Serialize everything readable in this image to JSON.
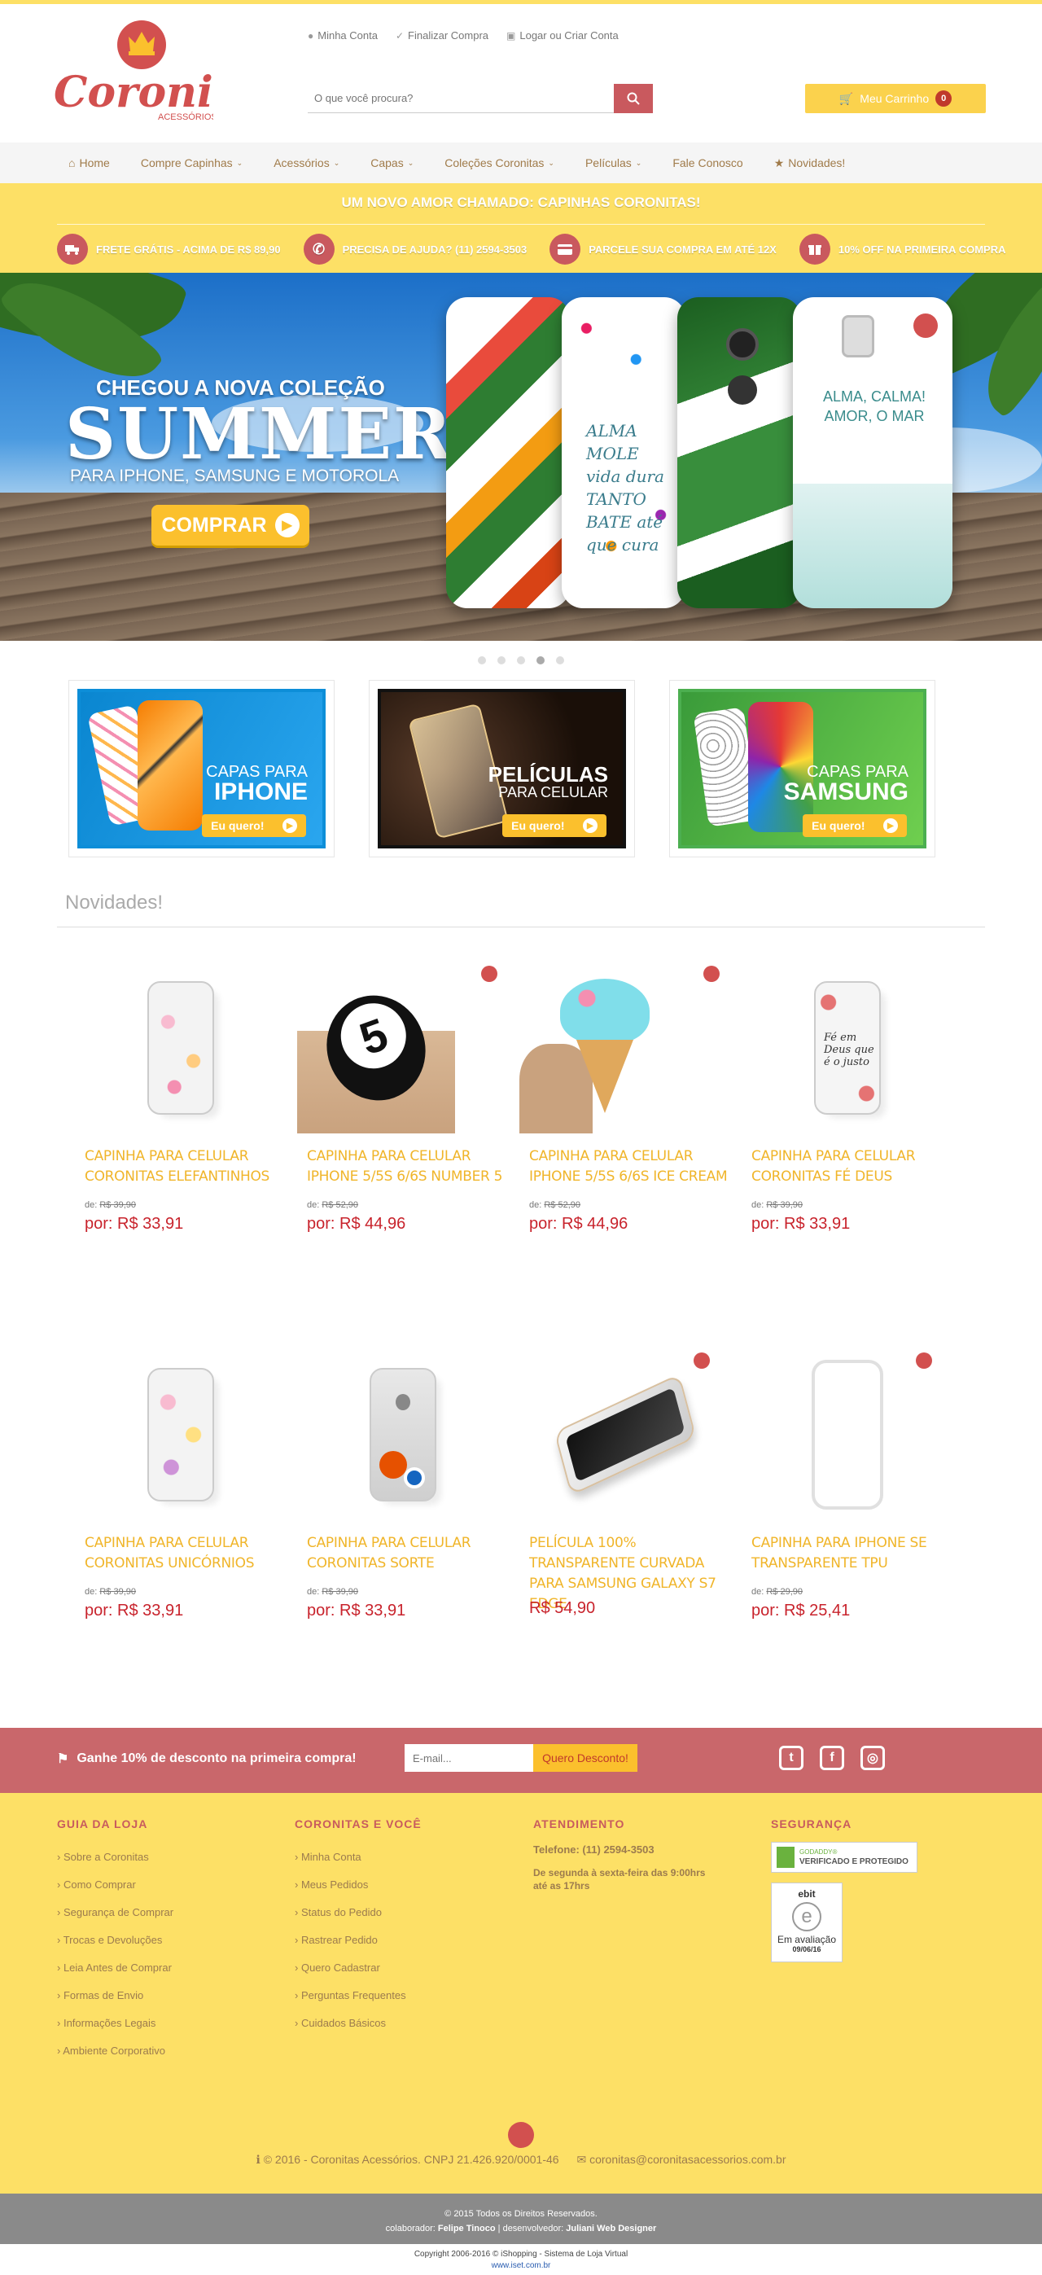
{
  "brand": {
    "name": "Coronitas",
    "tagline": "ACESSÓRIOS",
    "accent": "#c9595e",
    "yellow": "#fde066",
    "price_red": "#c8232c",
    "title_gold": "#f0b52a"
  },
  "account_links": [
    {
      "icon": "user-icon",
      "label": "Minha Conta"
    },
    {
      "icon": "check-icon",
      "label": "Finalizar Compra"
    },
    {
      "icon": "lock-icon",
      "label": "Logar ou Criar Conta"
    }
  ],
  "search": {
    "placeholder": "O que você procura?"
  },
  "cart": {
    "label": "Meu Carrinho",
    "count": "0"
  },
  "nav": [
    {
      "label": "Home",
      "icon": "home-icon"
    },
    {
      "label": "Compre Capinhas"
    },
    {
      "label": "Acessórios"
    },
    {
      "label": "Capas"
    },
    {
      "label": "Coleções Coronitas"
    },
    {
      "label": "Películas"
    },
    {
      "label": "Fale Conosco"
    },
    {
      "label": "Novidades!",
      "icon": "star-icon"
    }
  ],
  "promo_line": "UM NOVO AMOR CHAMADO: CAPINHAS CORONITAS!",
  "benefits": [
    {
      "icon": "truck-icon",
      "text": "FRETE GRÁTIS - ACIMA DE R$ 89,90"
    },
    {
      "icon": "phone-icon",
      "text": "PRECISA DE AJUDA? (11) 2594-3503"
    },
    {
      "icon": "card-icon",
      "text": "PARCELE SUA COMPRA EM ATÉ 12X"
    },
    {
      "icon": "gift-icon",
      "text": "10% OFF NA PRIMEIRA COMPRA"
    }
  ],
  "hero": {
    "kicker": "CHEGOU A NOVA COLEÇÃO",
    "title": "SUMMER",
    "subtitle": "PARA IPHONE, SAMSUNG E MOTOROLA",
    "cta": "COMPRAR",
    "case2_text": "ALMA MOLE vida dura TANTO BATE até que cura",
    "case4_text": "ALMA, CALMA! AMOR, O MAR",
    "dots": 5,
    "active_dot": 4
  },
  "categories": [
    {
      "small": "CAPAS PARA",
      "big": "IPHONE",
      "button": "Eu quero!"
    },
    {
      "small": "PARA CELULAR",
      "big": "PELÍCULAS",
      "button": "Eu quero!"
    },
    {
      "small": "CAPAS PARA",
      "big": "SAMSUNG",
      "button": "Eu quero!"
    }
  ],
  "section_title": "Novidades!",
  "products": [
    {
      "name": "CAPINHA PARA CELULAR CORONITAS ELEFANTINHOS",
      "old_label": "de:",
      "old": "R$ 39,90",
      "new": "por: R$ 33,91"
    },
    {
      "name": "CAPINHA PARA CELULAR IPHONE 5/5S 6/6S NUMBER 5",
      "old_label": "de:",
      "old": "R$ 52,90",
      "new": "por: R$ 44,96"
    },
    {
      "name": "CAPINHA PARA CELULAR IPHONE 5/5S 6/6S ICE CREAM",
      "old_label": "de:",
      "old": "R$ 52,90",
      "new": "por: R$ 44,96"
    },
    {
      "name": "CAPINHA PARA CELULAR CORONITAS FÉ DEUS",
      "old_label": "de:",
      "old": "R$ 39,90",
      "new": "por: R$ 33,91"
    },
    {
      "name": "CAPINHA PARA CELULAR CORONITAS UNICÓRNIOS",
      "old_label": "de:",
      "old": "R$ 39,90",
      "new": "por: R$ 33,91"
    },
    {
      "name": "CAPINHA PARA CELULAR CORONITAS SORTE",
      "old_label": "de:",
      "old": "R$ 39,90",
      "new": "por: R$ 33,91"
    },
    {
      "name": "PELÍCULA 100% TRANSPARENTE CURVADA PARA SAMSUNG GALAXY S7 EDGE",
      "old_label": "",
      "old": "",
      "new": "R$ 54,90"
    },
    {
      "name": "CAPINHA PARA IPHONE SE TRANSPARENTE TPU",
      "old_label": "de:",
      "old": "R$ 29,90",
      "new": "por: R$ 25,41"
    }
  ],
  "newsletter": {
    "text": "Ganhe 10% de desconto na primeira compra!",
    "placeholder": "E-mail...",
    "button": "Quero Desconto!",
    "social": [
      "twitter-icon",
      "facebook-icon",
      "instagram-icon"
    ]
  },
  "footer": {
    "guide": {
      "title": "GUIA DA LOJA",
      "links": [
        "Sobre a Coronitas",
        "Como Comprar",
        "Segurança de Comprar",
        "Trocas e Devoluções",
        "Leia Antes de Comprar",
        "Formas de Envio",
        "Informações Legais",
        "Ambiente Corporativo"
      ]
    },
    "you": {
      "title": "CORONITAS E VOCÊ",
      "links": [
        "Minha Conta",
        "Meus Pedidos",
        "Status do Pedido",
        "Rastrear Pedido",
        "Quero Cadastrar",
        "Perguntas Frequentes",
        "Cuidados Básicos"
      ]
    },
    "service": {
      "title": "ATENDIMENTO",
      "phone": "Telefone: (11) 2594-3503",
      "hours": "De segunda à sexta-feira das 9:00hrs até as 17hrs"
    },
    "security": {
      "title": "SEGURANÇA",
      "seal1": "VERIFICADO E PROTEGIDO",
      "seal1_brand": "GODADDY®",
      "seal2_brand": "ebit",
      "seal2_label": "Em avaliação",
      "seal2_date": "09/06/16"
    },
    "copyright": "© 2016 - Coronitas Acessórios. CNPJ 21.426.920/0001-46",
    "email": "coronitas@coronitasacessorios.com.br"
  },
  "legal": {
    "rights": "© 2015 Todos os Direitos Reservados.",
    "collab_label": "colaborador:",
    "collab": "Felipe Tinoco",
    "dev_label": "| desenvolvedor:",
    "dev": "Juliani Web Designer",
    "platform": "Copyright 2006-2016 © iShopping - Sistema de Loja Virtual",
    "url": "www.iset.com.br"
  }
}
